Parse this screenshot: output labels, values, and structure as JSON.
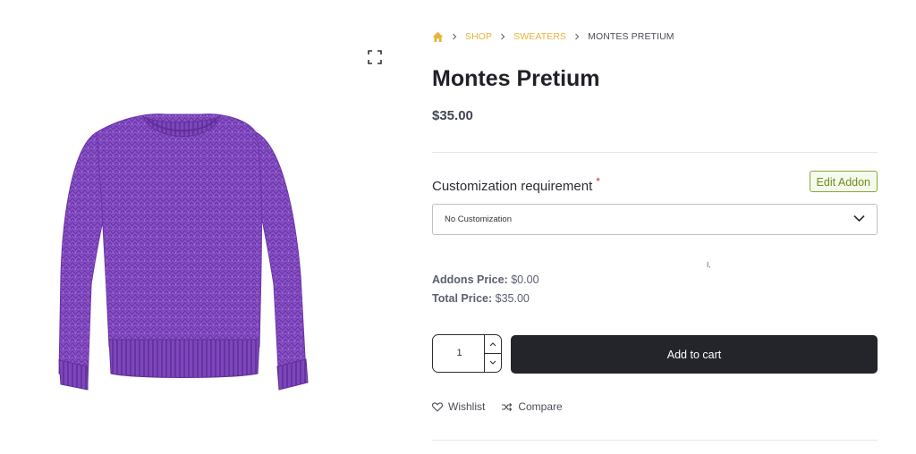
{
  "gallery": {
    "zoom_icon": "fullscreen-expand-icon",
    "image_alt": "Purple knit sweater",
    "image_color": "#8a52c9"
  },
  "breadcrumb": {
    "home_icon": "home-icon",
    "items": [
      "SHOP",
      "SWEATERS"
    ],
    "current": "MONTES PRETIUM",
    "link_color": "#e8b33a"
  },
  "product": {
    "title": "Montes Pretium",
    "price": "$35.00"
  },
  "addon": {
    "label": "Customization requirement",
    "required_mark": "*",
    "edit_label": "Edit Addon",
    "select": {
      "value": "No Customization",
      "icon": "chevron-down-icon"
    }
  },
  "cursor_glyph": "I,",
  "totals": {
    "addons_label": "Addons Price:",
    "addons_value": "$0.00",
    "total_label": "Total Price:",
    "total_value": "$35.00"
  },
  "cart": {
    "quantity": "1",
    "add_label": "Add to cart",
    "button_color": "#23252a"
  },
  "actions": {
    "wishlist": "Wishlist",
    "wishlist_icon": "heart-icon",
    "compare": "Compare",
    "compare_icon": "shuffle-icon"
  }
}
